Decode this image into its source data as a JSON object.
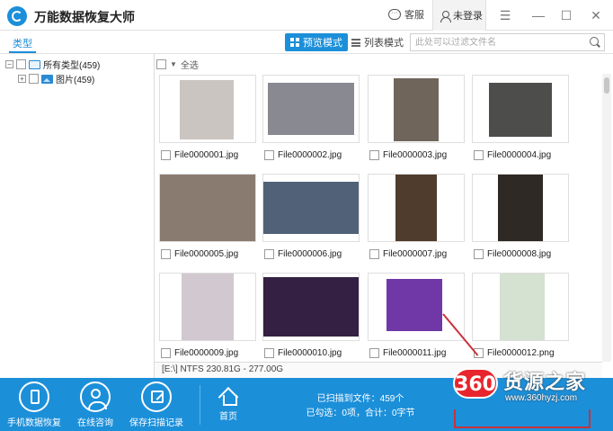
{
  "app": {
    "title": "万能数据恢复大师",
    "help_label": "客服",
    "login_label": "未登录"
  },
  "toolbar": {
    "type_tab": "类型",
    "preview_mode": "预览模式",
    "list_mode": "列表模式",
    "search_placeholder": "此处可以过滤文件名"
  },
  "tree": {
    "root_label": "所有类型(459)",
    "child_label": "图片(459)"
  },
  "content": {
    "select_all": "全选",
    "files": [
      {
        "name": "File0000001.jpg",
        "color": "#cfc9c4"
      },
      {
        "name": "File0000002.jpg",
        "color": "#8a8b92"
      },
      {
        "name": "File0000003.jpg",
        "color": "#6f6458"
      },
      {
        "name": "File0000004.jpg",
        "color": "#4a4a48"
      },
      {
        "name": "File0000005.jpg",
        "color": "#8b7b70"
      },
      {
        "name": "File0000006.jpg",
        "color": "#4f5f78"
      },
      {
        "name": "File0000007.jpg",
        "color": "#4d3828"
      },
      {
        "name": "File0000008.jpg",
        "color": "#2b2421"
      },
      {
        "name": "File0000009.jpg",
        "color": "#d5ccd4"
      },
      {
        "name": "File0000010.jpg",
        "color": "#2f1b3f"
      },
      {
        "name": "File0000011.jpg",
        "color": "#6e34a8"
      },
      {
        "name": "File0000012.png",
        "color": "#d9e6d5"
      }
    ]
  },
  "status": {
    "drive_info": "[E:\\] NTFS 230.81G - 277.00G"
  },
  "bottom": {
    "phone_recover": "手机数据恢复",
    "online_consult": "在线咨询",
    "save_scan": "保存扫描记录",
    "home": "首页",
    "scanned": "已扫描到文件：459个",
    "selected": "已勾选：0项，合计：0字节"
  },
  "watermark": {
    "badge": "360",
    "name": "货源之家",
    "url": "www.360hyzj.com"
  }
}
